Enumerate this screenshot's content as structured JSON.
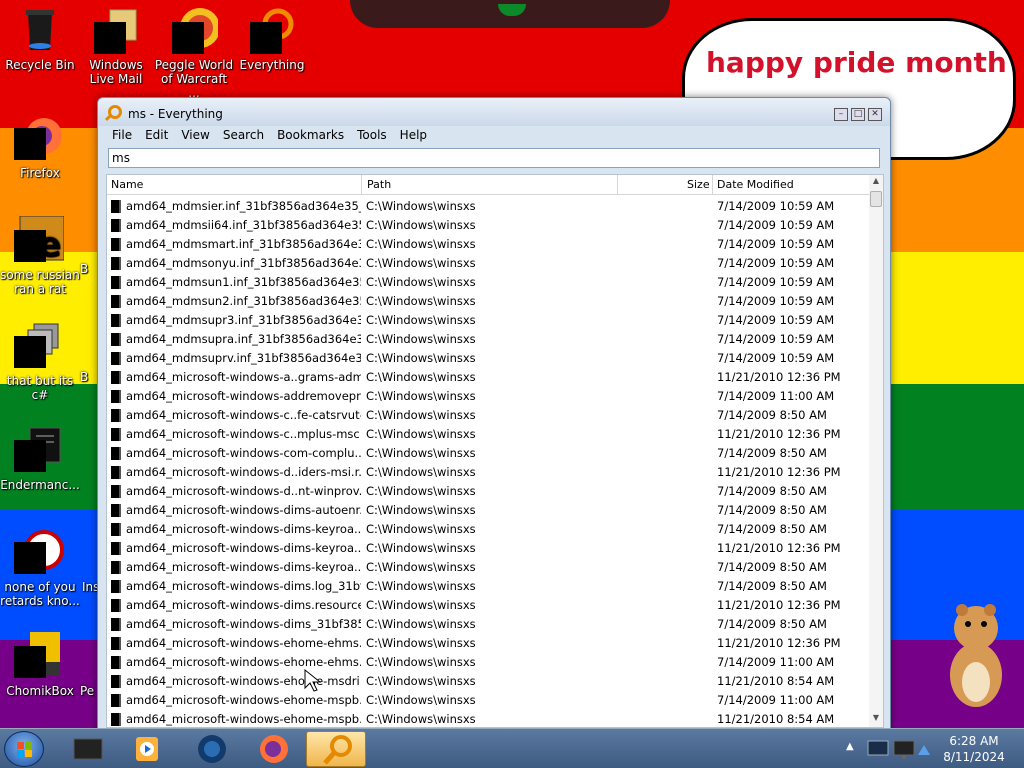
{
  "desktop": {
    "bubble_text": "happy pride month",
    "icons": [
      {
        "label": "Recycle Bin",
        "icon": "trash-icon"
      },
      {
        "label": "Windows Live Mail",
        "icon": "mail-icon"
      },
      {
        "label": "Peggle World of Warcraft ...",
        "icon": "peggle-icon"
      },
      {
        "label": "Everything",
        "icon": "everything-icon"
      },
      {
        "label": "Firefox",
        "icon": "firefox-icon"
      },
      {
        "label": "some russian ran a rat",
        "icon": "app-icon"
      },
      {
        "label": "that but its c#",
        "icon": "app-icon"
      },
      {
        "label": "Endermanc...",
        "icon": "app-icon"
      },
      {
        "label": "none of you retards kno...",
        "icon": "app-icon"
      },
      {
        "label": "ChomikBox",
        "icon": "chomikbox-icon"
      },
      {
        "label": "B",
        "icon": "app-icon"
      },
      {
        "label": "B",
        "icon": "app-icon"
      },
      {
        "label": "Ins",
        "icon": "app-icon"
      },
      {
        "label": "Pe",
        "icon": "app-icon"
      }
    ]
  },
  "window": {
    "title": "ms - Everything",
    "menu": [
      "File",
      "Edit",
      "View",
      "Search",
      "Bookmarks",
      "Tools",
      "Help"
    ],
    "search_value": "ms",
    "columns": {
      "name": "Name",
      "path": "Path",
      "size": "Size",
      "date": "Date Modified"
    },
    "rows": [
      {
        "name": "amd64_mdmsier.inf_31bf3856ad364e35_6....",
        "path": "C:\\Windows\\winsxs",
        "date": "7/14/2009 10:59 AM"
      },
      {
        "name": "amd64_mdmsii64.inf_31bf3856ad364e35_6...",
        "path": "C:\\Windows\\winsxs",
        "date": "7/14/2009 10:59 AM"
      },
      {
        "name": "amd64_mdmsmart.inf_31bf3856ad364e35_...",
        "path": "C:\\Windows\\winsxs",
        "date": "7/14/2009 10:59 AM"
      },
      {
        "name": "amd64_mdmsonyu.inf_31bf3856ad364e35_...",
        "path": "C:\\Windows\\winsxs",
        "date": "7/14/2009 10:59 AM"
      },
      {
        "name": "amd64_mdmsun1.inf_31bf3856ad364e35_...",
        "path": "C:\\Windows\\winsxs",
        "date": "7/14/2009 10:59 AM"
      },
      {
        "name": "amd64_mdmsun2.inf_31bf3856ad364e35_...",
        "path": "C:\\Windows\\winsxs",
        "date": "7/14/2009 10:59 AM"
      },
      {
        "name": "amd64_mdmsupr3.inf_31bf3856ad364e35_...",
        "path": "C:\\Windows\\winsxs",
        "date": "7/14/2009 10:59 AM"
      },
      {
        "name": "amd64_mdmsupra.inf_31bf3856ad364e35_...",
        "path": "C:\\Windows\\winsxs",
        "date": "7/14/2009 10:59 AM"
      },
      {
        "name": "amd64_mdmsuprv.inf_31bf3856ad364e35_...",
        "path": "C:\\Windows\\winsxs",
        "date": "7/14/2009 10:59 AM"
      },
      {
        "name": "amd64_microsoft-windows-a..grams-adm...",
        "path": "C:\\Windows\\winsxs",
        "date": "11/21/2010 12:36 PM"
      },
      {
        "name": "amd64_microsoft-windows-addremovepr...",
        "path": "C:\\Windows\\winsxs",
        "date": "7/14/2009 11:00 AM"
      },
      {
        "name": "amd64_microsoft-windows-c..fe-catsrvut-...",
        "path": "C:\\Windows\\winsxs",
        "date": "7/14/2009 8:50 AM"
      },
      {
        "name": "amd64_microsoft-windows-c..mplus-msc...",
        "path": "C:\\Windows\\winsxs",
        "date": "11/21/2010 12:36 PM"
      },
      {
        "name": "amd64_microsoft-windows-com-complu...",
        "path": "C:\\Windows\\winsxs",
        "date": "7/14/2009 8:50 AM"
      },
      {
        "name": "amd64_microsoft-windows-d..iders-msi.r...",
        "path": "C:\\Windows\\winsxs",
        "date": "11/21/2010 12:36 PM"
      },
      {
        "name": "amd64_microsoft-windows-d..nt-winprov...",
        "path": "C:\\Windows\\winsxs",
        "date": "7/14/2009 8:50 AM"
      },
      {
        "name": "amd64_microsoft-windows-dims-autoenr...",
        "path": "C:\\Windows\\winsxs",
        "date": "7/14/2009 8:50 AM"
      },
      {
        "name": "amd64_microsoft-windows-dims-keyroa...",
        "path": "C:\\Windows\\winsxs",
        "date": "7/14/2009 8:50 AM"
      },
      {
        "name": "amd64_microsoft-windows-dims-keyroa...",
        "path": "C:\\Windows\\winsxs",
        "date": "11/21/2010 12:36 PM"
      },
      {
        "name": "amd64_microsoft-windows-dims-keyroa...",
        "path": "C:\\Windows\\winsxs",
        "date": "7/14/2009 8:50 AM"
      },
      {
        "name": "amd64_microsoft-windows-dims.log_31bf...",
        "path": "C:\\Windows\\winsxs",
        "date": "7/14/2009 8:50 AM"
      },
      {
        "name": "amd64_microsoft-windows-dims.resource...",
        "path": "C:\\Windows\\winsxs",
        "date": "11/21/2010 12:36 PM"
      },
      {
        "name": "amd64_microsoft-windows-dims_31bf385...",
        "path": "C:\\Windows\\winsxs",
        "date": "7/14/2009 8:50 AM"
      },
      {
        "name": "amd64_microsoft-windows-ehome-ehms...",
        "path": "C:\\Windows\\winsxs",
        "date": "11/21/2010 12:36 PM"
      },
      {
        "name": "amd64_microsoft-windows-ehome-ehms...",
        "path": "C:\\Windows\\winsxs",
        "date": "7/14/2009 11:00 AM"
      },
      {
        "name": "amd64_microsoft-windows-ehome-msdri...",
        "path": "C:\\Windows\\winsxs",
        "date": "11/21/2010 8:54 AM"
      },
      {
        "name": "amd64_microsoft-windows-ehome-mspb...",
        "path": "C:\\Windows\\winsxs",
        "date": "7/14/2009 11:00 AM"
      },
      {
        "name": "amd64_microsoft-windows-ehome-mspb...",
        "path": "C:\\Windows\\winsxs",
        "date": "11/21/2010 8:54 AM"
      }
    ]
  },
  "taskbar": {
    "time": "6:28 AM",
    "date": "8/11/2024",
    "buttons": [
      "media-center-icon",
      "media-player-icon",
      "network-app-icon",
      "firefox-icon",
      "everything-icon"
    ]
  },
  "colors": {
    "red": "#e50000",
    "orange": "#ff8d00",
    "yellow": "#ffee00",
    "green": "#028121",
    "blue": "#004cff",
    "purple": "#770088",
    "bubble_text": "#d4112b"
  }
}
